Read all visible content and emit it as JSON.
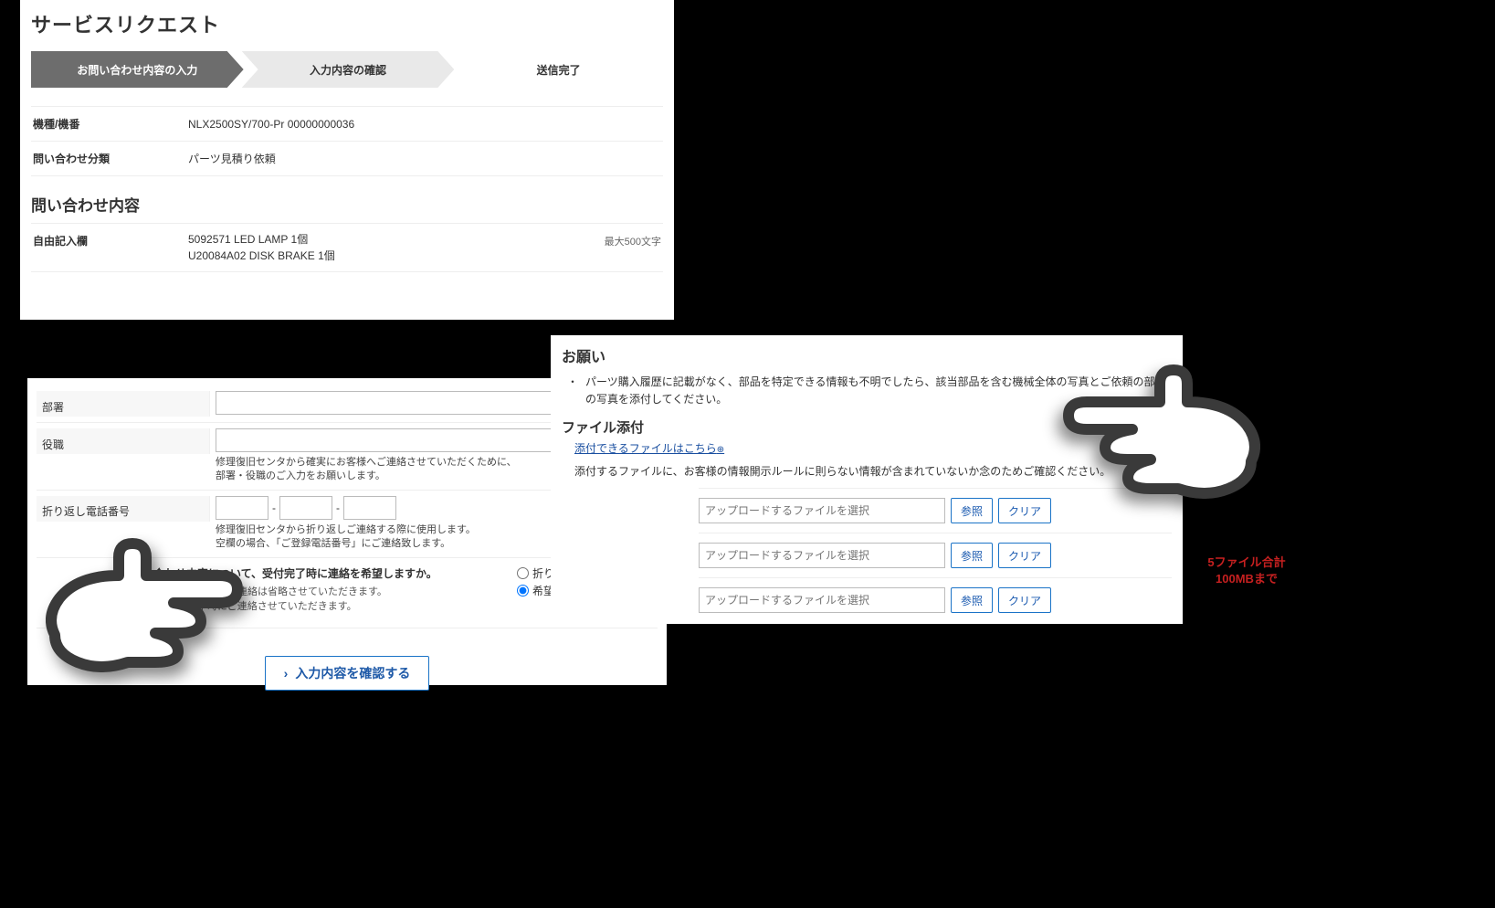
{
  "panel1": {
    "title": "サービスリクエスト",
    "steps": {
      "s1": "お問い合わせ内容の入力",
      "s2": "入力内容の確認",
      "s3": "送信完了"
    },
    "rows": {
      "model_label": "機種/機番",
      "model_value": "NLX2500SY/700-Pr 00000000036",
      "category_label": "問い合わせ分類",
      "category_value": "パーツ見積り依頼"
    },
    "section_title": "問い合わせ内容",
    "free": {
      "label": "自由記入欄",
      "value": "5092571 LED LAMP 1個\nU20084A02 DISK BRAKE 1個",
      "note": "最大500文字"
    }
  },
  "panel2": {
    "department": {
      "label": "部署"
    },
    "position": {
      "label": "役職",
      "hint": "修理復旧センタから確実にお客様へご連絡させていただくために、\n部署・役職のご入力をお願いします。"
    },
    "tel": {
      "label": "折り返し電話番号",
      "hint": "修理復旧センタから折り返しご連絡する際に使用します。\n空欄の場合、「ご登録電話番号」にご連絡致します。"
    },
    "callback": {
      "head": "問い合わせ内容について、受付完了時に連絡を希望しますか。",
      "line1": "い」を選択された場合、受付時のご連絡は省略させていただきます。",
      "line2": "時や部品発送時など対応完了時にご連絡させていただきます。",
      "opt_yes": "折り返し連絡を希",
      "opt_no": "希望しない"
    },
    "confirm": "入力内容を確認する"
  },
  "panel3": {
    "title": "お願い",
    "bullet": "パーツ購入履歴に記載がなく、部品を特定できる情報も不明でしたら、該当部品を含む機械全体の写真とご依頼の部品の写真を添付してください。",
    "attach_title": "ファイル添付",
    "attach_link": "添付できるファイルはこちら",
    "attach_ext": "⊕",
    "attach_note": "添付するファイルに、お客様の情報開示ルールに則らない情報が含まれていないか念のためご確認ください。",
    "upload_placeholder": "アップロードするファイルを選択",
    "browse": "参照",
    "clear": "クリア",
    "limit": "5ファイル合計\n100MBまで"
  }
}
